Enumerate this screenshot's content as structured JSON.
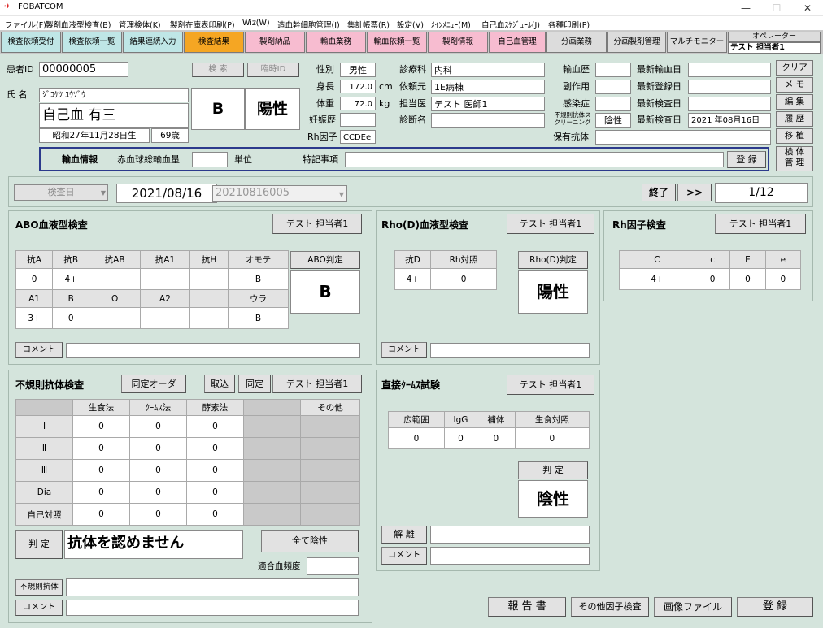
{
  "window": {
    "title": "FOBATCOM"
  },
  "menu": [
    "ファイル(F)",
    "製剤血液型検査(B)",
    "管理検体(K)",
    "製剤在庫表印刷(P)",
    "Wiz(W)",
    "造血幹細胞管理(I)",
    "集計帳票(R)",
    "設定(V)",
    "ﾒｲﾝﾒﾆｭｰ(M)",
    "自己血ｽｹｼﾞｭｰﾙ(J)",
    "各種印刷(P)"
  ],
  "tabs": [
    "検査依頼受付",
    "検査依頼一覧",
    "結果連続入力",
    "検査結果",
    "製剤納品",
    "輸血業務",
    "輸血依頼一覧",
    "製剤情報",
    "自己血管理",
    "分画業務",
    "分画製剤管理",
    "マルチモニター"
  ],
  "operator": {
    "label": "オペレーター",
    "name": "テスト 担当者1"
  },
  "patient": {
    "id_label": "患者ID",
    "id": "00000005",
    "search": "検 索",
    "temp_id": "臨時ID",
    "name_label": "氏 名",
    "kana": "ｼﾞｺｹﾂ ﾕｳｿﾞｳ",
    "name": "自己血 有三",
    "birth": "昭和27年11月28日生",
    "age": "69歳",
    "abo": "B",
    "rh": "陽性",
    "sex_label": "性別",
    "sex": "男性",
    "height_label": "身長",
    "height": "172.0",
    "height_unit": "cm",
    "weight_label": "体重",
    "weight": "72.0",
    "weight_unit": "kg",
    "preg_label": "妊娠歴",
    "preg": "",
    "rhfactor_label": "Rh因子",
    "rhfactor": "CCDEe",
    "dept_label": "診療科",
    "dept": "内科",
    "ward_label": "依頼元",
    "ward": "1E病棟",
    "doctor_label": "担当医",
    "doctor": "テスト 医師1",
    "diag_label": "診断名",
    "diag": "",
    "hist_label": "輸血歴",
    "hist": "",
    "side_label": "副作用",
    "side": "",
    "infect_label": "感染症",
    "infect": "",
    "screen_label": "不規則抗体スクリーニング",
    "screen": "陰性",
    "antibody_label": "保有抗体",
    "antibody": "",
    "last_trans_label": "最新輸血日",
    "last_trans": "",
    "last_reg_label": "最新登録日",
    "last_reg": "",
    "last_exam_label": "最新検査日",
    "last_exam": "",
    "last_exam2_label": "最新検査日",
    "last_exam2": "2021 年08月16日"
  },
  "transfusion": {
    "label": "輸血情報",
    "rbc_label": "赤血球総輸血量",
    "rbc": "",
    "unit": "単位",
    "note_label": "特記事項",
    "note": "",
    "register": "登 録"
  },
  "side_buttons": [
    "クリア",
    "メ モ",
    "編 集",
    "履 歴",
    "移 植",
    "検 体\n管 理"
  ],
  "exam": {
    "date_label": "検査日",
    "date": "2021/08/16",
    "exam_no": "20210816005",
    "end": "終了",
    "next": ">>",
    "page": "1/12"
  },
  "abo": {
    "title": "ABO血液型検査",
    "tester": "テスト 担当者1",
    "front_headers": [
      "抗A",
      "抗B",
      "抗AB",
      "抗A1",
      "抗H",
      "オモテ"
    ],
    "front_values": [
      "0",
      "4+",
      "",
      "",
      "",
      "B"
    ],
    "back_headers": [
      "A1",
      "B",
      "O",
      "A2",
      "",
      "ウラ"
    ],
    "back_values": [
      "3+",
      "0",
      "",
      "",
      "",
      "B"
    ],
    "judge_label": "ABO判定",
    "judge": "B",
    "comment": "コメント"
  },
  "rhd": {
    "title": "Rho(D)血液型検査",
    "tester": "テスト 担当者1",
    "headers": [
      "抗D",
      "Rh対照"
    ],
    "values": [
      "4+",
      "0"
    ],
    "judge_label": "Rho(D)判定",
    "judge": "陽性",
    "comment": "コメント"
  },
  "rhf": {
    "title": "Rh因子検査",
    "tester": "テスト 担当者1",
    "headers": [
      "C",
      "c",
      "E",
      "e"
    ],
    "values": [
      "4+",
      "0",
      "0",
      "0"
    ]
  },
  "irreg": {
    "title": "不規則抗体検査",
    "order": "同定オーダ",
    "import": "取込",
    "identify": "同定",
    "tester": "テスト 担当者1",
    "headers": [
      "生食法",
      "ｸｰﾑｽ法",
      "酵素法",
      "",
      "その他"
    ],
    "rows": [
      {
        "label": "Ⅰ",
        "v": [
          "0",
          "0",
          "0"
        ]
      },
      {
        "label": "Ⅱ",
        "v": [
          "0",
          "0",
          "0"
        ]
      },
      {
        "label": "Ⅲ",
        "v": [
          "0",
          "0",
          "0"
        ]
      },
      {
        "label": "Dia",
        "v": [
          "0",
          "0",
          "0"
        ]
      },
      {
        "label": "自己対照",
        "v": [
          "0",
          "0",
          "0"
        ]
      }
    ],
    "judge_label": "判 定",
    "judge": "抗体を認めません",
    "all_neg": "全て陰性",
    "freq_label": "適合血頻度",
    "irr_label": "不規則抗体",
    "comment": "コメント"
  },
  "dat": {
    "title": "直接ｸｰﾑｽ試験",
    "tester": "テスト 担当者1",
    "headers": [
      "広範囲",
      "IgG",
      "補体",
      "生食対照"
    ],
    "values": [
      "0",
      "0",
      "0",
      "0"
    ],
    "judge_label": "判 定",
    "judge": "陰性",
    "dissoc": "解 離",
    "comment": "コメント"
  },
  "footer": {
    "report": "報 告 書",
    "other": "その他因子検査",
    "image": "画像ファイル",
    "register": "登 録"
  },
  "colors": {
    "tab_cyan": "#bfe6e6",
    "tab_orange": "#f5a623",
    "tab_pink": "#f7bcd0",
    "tab_gray": "#dcdcdc"
  }
}
